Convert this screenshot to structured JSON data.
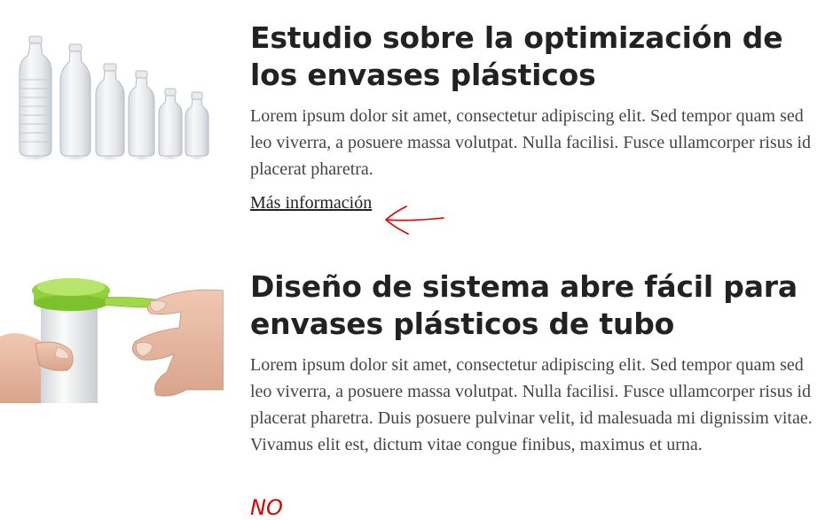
{
  "articles": [
    {
      "title": "Estudio sobre la optimización de los envases plásticos",
      "excerpt": "Lorem ipsum dolor sit amet, consectetur adipiscing elit. Sed tempor quam sed leo viverra, a posuere massa volutpat. Nulla facilisi. Fusce ullamcorper risus id placerat pharetra.",
      "link_label": "Más información",
      "image": "plastic-bottles-image"
    },
    {
      "title": "Diseño de sistema abre fácil para envases plásticos de tubo",
      "excerpt": "Lorem ipsum dolor sit amet, consectetur adipiscing elit. Sed tempor quam sed leo viverra, a posuere massa volutpat. Nulla facilisi. Fusce ullamcorper risus id placerat pharetra. Duis posuere pulvinar velit, id malesuada mi dignissim vitae. Vivamus elit est, dictum vitae congue finibus, maximus et urna.",
      "image": "tube-cap-hand-image"
    }
  ],
  "annotations": {
    "note_text": "NO",
    "color": "#e00000"
  }
}
